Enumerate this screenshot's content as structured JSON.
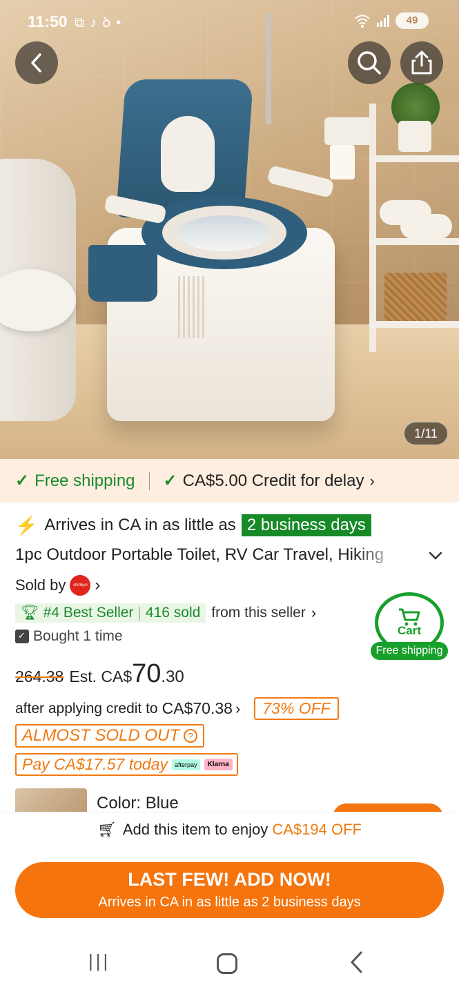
{
  "status_bar": {
    "time": "11:50",
    "battery": "49"
  },
  "gallery": {
    "counter": "1/11"
  },
  "shipping_strip": {
    "free_shipping": "Free shipping",
    "credit": "CA$5.00 Credit for delay"
  },
  "product": {
    "arrives_prefix": "Arrives in CA in as little as",
    "arrives_highlight": "2 business days",
    "title": "1pc Outdoor Portable Toilet, RV Car Travel, Hiking",
    "sold_by": "Sold by",
    "seller_logo_text": "shirleyo",
    "best_seller": "#4 Best Seller",
    "sold_count": "416 sold",
    "from_seller": "from this seller",
    "bought": "Bought 1 time",
    "original_price": "264.38",
    "est_label": "Est. CA$",
    "price_whole": "70",
    "price_decimal": ".30",
    "after_credit_label": "after applying credit to",
    "after_credit_price": "CA$70.38",
    "off_badge": "73% OFF",
    "almost_sold_out": "ALMOST SOLD OUT",
    "pay_today": "Pay CA$17.57 today",
    "afterpay": "afterpay",
    "klarna": "Klarna",
    "color_label": "Color: Blue"
  },
  "floating_cart": {
    "label": "Cart",
    "badge": "Free shipping"
  },
  "bottom": {
    "promo_prefix": "Add this item to enjoy",
    "promo_amount": "CA$194 OFF",
    "cta_main": "LAST FEW! ADD NOW!",
    "cta_sub": "Arrives in CA in as little as 2 business days"
  },
  "colors": {
    "accent_orange": "#f5740d",
    "green": "#1a8a2a",
    "strip_bg": "#fdeee0"
  }
}
